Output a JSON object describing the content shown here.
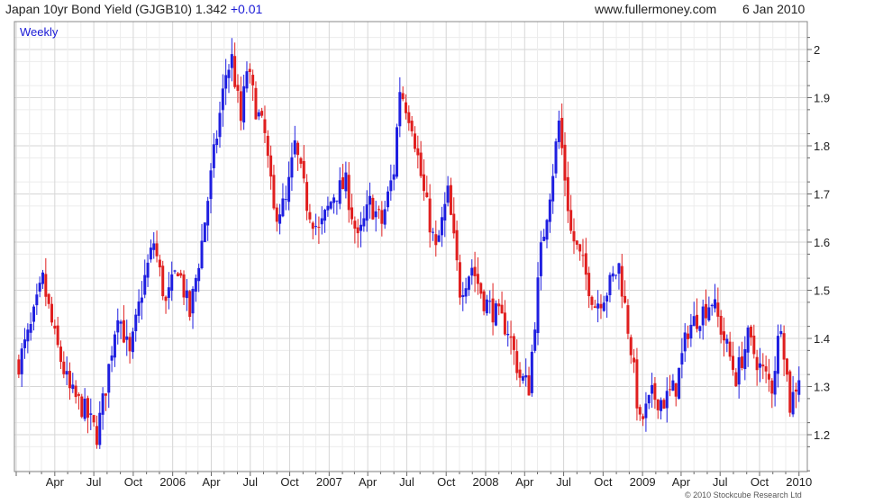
{
  "header": {
    "series_title": "Japan 10yr Bond Yield (GJGB10)",
    "last_value": "1.342",
    "change": "+0.01",
    "site": "www.fullermoney.com",
    "date": "6 Jan 2010"
  },
  "footer": {
    "copyright": "© 2010 Stockcube Research Ltd"
  },
  "colors": {
    "up": "#1f1fe0",
    "down": "#e01f1f",
    "grid": "#d6d6d6",
    "frame": "#888888",
    "period_label": "#1a1ad6"
  },
  "chart_data": {
    "type": "candlestick",
    "period_label": "Weekly",
    "x_tick_labels": [
      "Apr",
      "Jul",
      "Oct",
      "2006",
      "Apr",
      "Jul",
      "Oct",
      "2007",
      "Apr",
      "Jul",
      "Oct",
      "2008",
      "Apr",
      "Jul",
      "Oct",
      "2009",
      "Apr",
      "Jul",
      "Oct",
      "2010"
    ],
    "y_ticks": [
      1.2,
      1.3,
      1.4,
      1.5,
      1.6,
      1.7,
      1.8,
      1.9,
      2
    ],
    "y_tick_labels": [
      "1.2",
      "1.3",
      "1.4",
      "1.5",
      "1.6",
      "1.7",
      "1.8",
      "1.9",
      "2"
    ],
    "ylim": [
      1.125,
      2.04
    ],
    "y_axis_side": "right",
    "grid": true,
    "close_path": [
      [
        "2005-01-07",
        1.35
      ],
      [
        "2005-02-04",
        1.42
      ],
      [
        "2005-03-04",
        1.52
      ],
      [
        "2005-04-01",
        1.4
      ],
      [
        "2005-05-06",
        1.29
      ],
      [
        "2005-06-10",
        1.25
      ],
      [
        "2005-07-08",
        1.2
      ],
      [
        "2005-07-29",
        1.3
      ],
      [
        "2005-08-26",
        1.46
      ],
      [
        "2005-09-23",
        1.36
      ],
      [
        "2005-10-21",
        1.5
      ],
      [
        "2005-11-18",
        1.6
      ],
      [
        "2005-12-16",
        1.47
      ],
      [
        "2006-01-13",
        1.55
      ],
      [
        "2006-02-10",
        1.45
      ],
      [
        "2006-03-10",
        1.6
      ],
      [
        "2006-04-07",
        1.78
      ],
      [
        "2006-05-05",
        1.95
      ],
      [
        "2006-05-19",
        1.98
      ],
      [
        "2006-06-09",
        1.85
      ],
      [
        "2006-06-23",
        1.96
      ],
      [
        "2006-07-14",
        1.88
      ],
      [
        "2006-08-04",
        1.82
      ],
      [
        "2006-08-25",
        1.66
      ],
      [
        "2006-09-22",
        1.68
      ],
      [
        "2006-10-13",
        1.8
      ],
      [
        "2006-11-10",
        1.68
      ],
      [
        "2006-12-08",
        1.62
      ],
      [
        "2007-01-12",
        1.7
      ],
      [
        "2007-02-09",
        1.72
      ],
      [
        "2007-03-09",
        1.6
      ],
      [
        "2007-04-06",
        1.68
      ],
      [
        "2007-05-04",
        1.64
      ],
      [
        "2007-06-01",
        1.75
      ],
      [
        "2007-06-15",
        1.92
      ],
      [
        "2007-07-13",
        1.85
      ],
      [
        "2007-08-10",
        1.7
      ],
      [
        "2007-09-07",
        1.58
      ],
      [
        "2007-10-05",
        1.7
      ],
      [
        "2007-11-02",
        1.5
      ],
      [
        "2007-11-30",
        1.55
      ],
      [
        "2007-12-28",
        1.48
      ],
      [
        "2008-01-25",
        1.45
      ],
      [
        "2008-02-22",
        1.42
      ],
      [
        "2008-03-21",
        1.32
      ],
      [
        "2008-04-11",
        1.3
      ],
      [
        "2008-05-09",
        1.58
      ],
      [
        "2008-06-06",
        1.75
      ],
      [
        "2008-06-20",
        1.85
      ],
      [
        "2008-07-18",
        1.62
      ],
      [
        "2008-08-15",
        1.55
      ],
      [
        "2008-09-12",
        1.47
      ],
      [
        "2008-10-10",
        1.5
      ],
      [
        "2008-11-07",
        1.55
      ],
      [
        "2008-12-05",
        1.38
      ],
      [
        "2008-12-26",
        1.22
      ],
      [
        "2009-01-23",
        1.28
      ],
      [
        "2009-02-20",
        1.27
      ],
      [
        "2009-03-20",
        1.3
      ],
      [
        "2009-04-17",
        1.42
      ],
      [
        "2009-05-15",
        1.45
      ],
      [
        "2009-06-12",
        1.48
      ],
      [
        "2009-07-10",
        1.4
      ],
      [
        "2009-08-07",
        1.32
      ],
      [
        "2009-09-04",
        1.4
      ],
      [
        "2009-10-02",
        1.34
      ],
      [
        "2009-10-30",
        1.3
      ],
      [
        "2009-11-20",
        1.44
      ],
      [
        "2009-12-11",
        1.26
      ],
      [
        "2010-01-06",
        1.34
      ]
    ]
  }
}
